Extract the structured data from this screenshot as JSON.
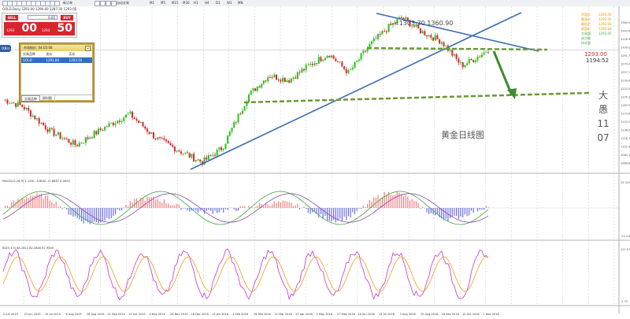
{
  "toolbar": {
    "items": [
      "新订单",
      "自动交易"
    ],
    "timeframes": [
      "M1",
      "M5",
      "M15",
      "M30",
      "H1",
      "H4",
      "D1",
      "W1",
      "MN"
    ]
  },
  "chart": {
    "ohlc_header": "GOLD,Daily  1293.00 1296.60 1287.30 1293.00",
    "macd_header": "MACD(12,26,9) 1.1281 -4.8061 11.8887 0.0000",
    "kd_header": "KD(5,3,3) 84.1611 82.2846 87.9540",
    "annotation_peak": "<1303.30 1360.90",
    "chinese_title": "黄金日线图",
    "vertical_text": [
      "大",
      "愚",
      "11",
      "07"
    ],
    "right_values": [
      "1293.00",
      "1295.00",
      "1293.00",
      "1293.00",
      "1293.00"
    ],
    "right_current": "1293.00",
    "right_time": "1194:52",
    "right_labels": [
      "开盘价",
      "最高价",
      "最低价",
      "收盘价",
      "交易量",
      "成交额",
      "持仓量"
    ],
    "macd_scale_top": "25.3196",
    "macd_scale_bottom": "-25.4186",
    "kd_scale_top": "127.07",
    "kd_scale_bottom": "-1.75",
    "price_scale": [
      "1360.90",
      "1343.60",
      "1326.30",
      "1309.00",
      "1291.70",
      "1274.40",
      "1257.10",
      "1239.80",
      "1222.50",
      "1205.20",
      "1187.90",
      "1170.60",
      "1153.30",
      "1136.00",
      "1118.70",
      "1101.40",
      "1084.10",
      "1066.80"
    ],
    "date_labels": [
      "2 Jun 2015",
      "23 Jun 2015",
      "15 Jul 2015",
      "6 Aug 2015",
      "28 Aug 2015",
      "21 Sep 2015",
      "13 Oct 2015",
      "4 Nov 2015",
      "26 Nov 2015",
      "18 Dec 2015",
      "13 Jan 2016",
      "4 Feb 2016",
      "26 Feb 2016",
      "21 Mar 2016",
      "13 Apr 2016",
      "5 May 2016",
      "27 May 2016",
      "20 Jun 2016",
      "12 Jul 2016",
      "3 Aug 2016",
      "25 Aug 2016",
      "16 Sep 2016",
      "10 Oct 2016",
      "1 Nov 2016"
    ]
  },
  "trade_panel": {
    "sell_label": "SELL",
    "buy_label": "BUY",
    "lot": "0.05",
    "sell_small": "1293",
    "sell_big": "00",
    "buy_small": "1293",
    "buy_big": "50"
  },
  "side_tag": "IXBrs",
  "market_window": {
    "title": "市场报价: 04:05:08",
    "headers": [
      "交易品种",
      "卖价",
      "买价"
    ],
    "row": [
      "GOLD",
      "1293.00",
      "1293.50"
    ],
    "tabs": [
      "交易品种",
      "即时图"
    ]
  }
}
